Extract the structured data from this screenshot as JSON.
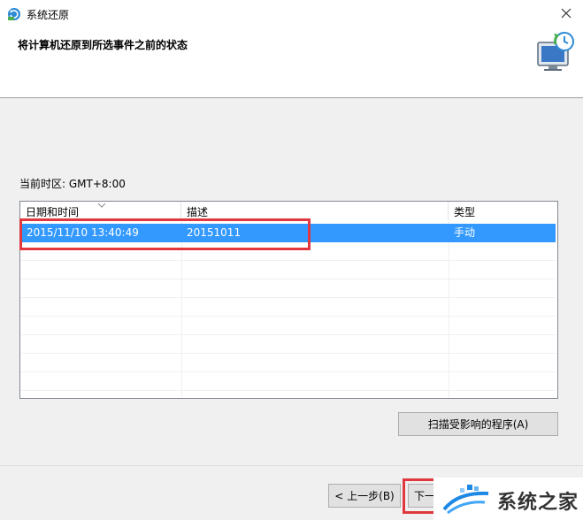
{
  "window": {
    "title": "系统还原",
    "heading": "将计算机还原到所选事件之前的状态"
  },
  "timezone_label": "当前时区: GMT+8:00",
  "table": {
    "columns": [
      "日期和时间",
      "描述",
      "类型"
    ],
    "rows": [
      {
        "date": "2015/11/10 13:40:49",
        "description": "20151011",
        "type": "手动",
        "selected": true
      }
    ]
  },
  "buttons": {
    "scan": "扫描受影响的程序(A)",
    "back": "< 上一步(B)",
    "next": "下一"
  },
  "watermark": {
    "text": "系统之家"
  },
  "colors": {
    "selection": "#3399ff",
    "highlight": "#e0383e"
  }
}
